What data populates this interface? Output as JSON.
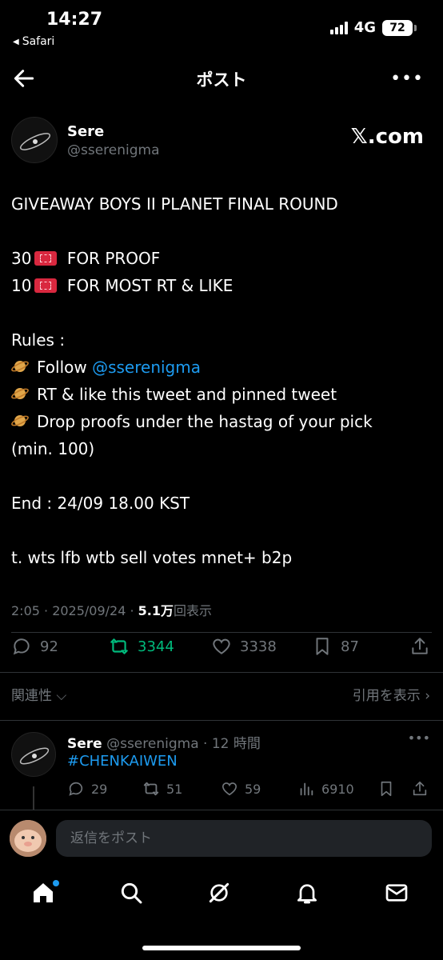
{
  "status_bar": {
    "time": "14:27",
    "back_app": "Safari",
    "network": "4G",
    "battery": "72"
  },
  "header": {
    "title": "ポスト"
  },
  "tweet": {
    "author_name": "Sere",
    "author_handle": "@sserenigma",
    "source_label": "𝕏.com",
    "lines": {
      "title": "GIVEAWAY BOYS II PLANET FINAL ROUND",
      "proof_count": "30",
      "proof_text": "FOR PROOF",
      "most_count": "10",
      "most_text": "FOR MOST RT & LIKE",
      "rules": "Rules :",
      "rule1_prefix": "Follow ",
      "rule1_mention": "@sserenigma",
      "rule2": "RT & like this tweet and pinned tweet",
      "rule3": "Drop proofs under the hastag of your pick",
      "rule3_cont": "(min. 100)",
      "end": "End : 24/09 18.00 KST",
      "tags": "t. wts lfb wtb sell votes mnet+ b2p"
    },
    "meta_time": "2:05 · 2025/09/24 · ",
    "meta_views": "5.1万",
    "meta_views_label": "回表示",
    "stats": {
      "replies": "92",
      "retweets": "3344",
      "likes": "3338",
      "bookmarks": "87"
    }
  },
  "subbar": {
    "sort": "関連性 ⌵",
    "quotes": "引用を表示 ›"
  },
  "reply": {
    "name": "Sere",
    "handle_time": " @sserenigma · 12 時間",
    "hashtag": "#CHENKAIWEN",
    "stats": {
      "replies": "29",
      "retweets": "51",
      "likes": "59",
      "views": "6910"
    }
  },
  "composer": {
    "placeholder": "返信をポスト"
  },
  "colors": {
    "accent": "#1d9bf0",
    "retweet": "#00ba7c",
    "muted": "#71767b",
    "background": "#000000"
  }
}
